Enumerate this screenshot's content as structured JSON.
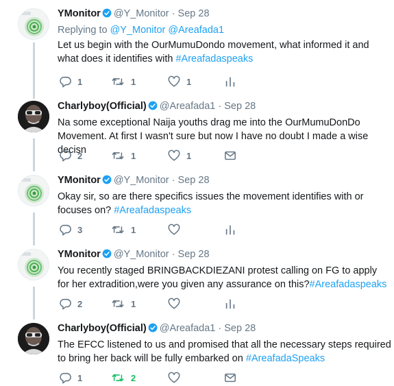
{
  "tweets": [
    {
      "name": "YMonitor",
      "handle": "@Y_Monitor",
      "dot": "·",
      "date": "Sep 28",
      "replying_prefix": "Replying to",
      "replying_mentions": "@Y_Monitor @Areafada1",
      "text": "Let us begin with the OurMumuDondo movement, what informed it and what does it identifies with ",
      "hashtag": "#Areafadaspeaks",
      "replies": "1",
      "retweets": "1",
      "likes": "1",
      "last_icon": "analytics-icon"
    },
    {
      "name": "Charlyboy(Official)",
      "handle": "@Areafada1",
      "dot": "·",
      "date": "Sep 28",
      "text": "Na some exceptional Naija youths drag me into the OurMumuDonDo Movement. At first I wasn't sure but now I have no doubt I made a wise decisn",
      "hashtag": "",
      "replies": "2",
      "retweets": "1",
      "likes": "1",
      "last_icon": "message-icon"
    },
    {
      "name": "YMonitor",
      "handle": "@Y_Monitor",
      "dot": "·",
      "date": "Sep 28",
      "text": "Okay sir, so are there specifics issues the movement identifies with or focuses on? ",
      "hashtag": "#Areafadaspeaks",
      "replies": "3",
      "retweets": "1",
      "likes": "",
      "last_icon": "analytics-icon"
    },
    {
      "name": "YMonitor",
      "handle": "@Y_Monitor",
      "dot": "·",
      "date": "Sep 28",
      "text": "You recently staged BRINGBACKDIEZANI protest calling on FG to apply for her extradition,were you given any assurance on this?",
      "hashtag": "#Areafadaspeaks",
      "replies": "2",
      "retweets": "1",
      "likes": "",
      "last_icon": "analytics-icon"
    },
    {
      "name": "Charlyboy(Official)",
      "handle": "@Areafada1",
      "dot": "·",
      "date": "Sep 28",
      "text": "The EFCC listened to us and promised that all the necessary steps required to bring her back will be fully  embarked on ",
      "hashtag": "#AreafadaSpeaks",
      "replies": "1",
      "retweets": "2",
      "likes": "",
      "last_icon": "message-icon"
    }
  ],
  "colors": {
    "link": "#1da1f2",
    "secondary": "#657786",
    "retweet_active": "#17bf63",
    "thread_line": "#ccd6dd"
  }
}
